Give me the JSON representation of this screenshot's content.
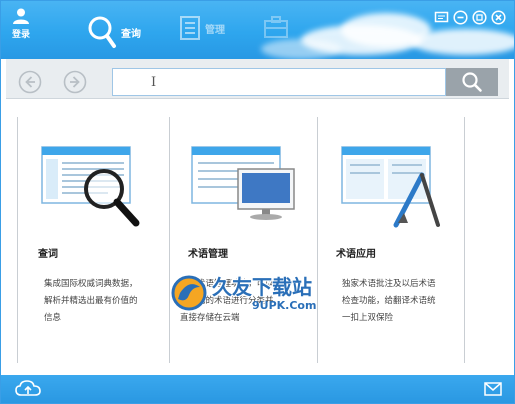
{
  "colors": {
    "titlebar": "#2ea6ee",
    "toolbar": "#e9edf0",
    "search_button": "#9aa3aa",
    "divider": "#c9ced3"
  },
  "header": {
    "login_label": "登录",
    "tabs": [
      {
        "label": "查询",
        "icon": "magnifier-icon",
        "active": true
      },
      {
        "label": "管理",
        "icon": "document-list-icon",
        "active": false
      },
      {
        "label": "",
        "icon": "briefcase-icon",
        "active": false
      }
    ],
    "window_controls": [
      "feedback-icon",
      "minimize-icon",
      "restore-icon",
      "close-icon"
    ]
  },
  "toolbar": {
    "back_icon": "arrow-left-icon",
    "forward_icon": "arrow-right-icon",
    "search_value": "",
    "search_icon": "search-icon"
  },
  "cards": [
    {
      "title": "查词",
      "desc": [
        "集成国际权威词典数据，",
        "解析并精选出最有价值的",
        "信息"
      ],
      "image": "dictionary-magnifier-illustration"
    },
    {
      "title": "术语管理",
      "desc": [
        "云端术语管理功能，可以",
        "对自己的术语进行分类并",
        "直接存储在云端"
      ],
      "image": "term-cloud-illustration"
    },
    {
      "title": "术语应用",
      "desc": [
        "独家术语批注及以后术语",
        "检查功能，给翻译术语统",
        "一扣上双保险"
      ],
      "image": "term-pen-illustration"
    }
  ],
  "watermark": {
    "title": "久友下载站",
    "url": "9UPK.Com"
  },
  "footer": {
    "left_icon": "cloud-icon",
    "right_icon": "mail-icon"
  }
}
